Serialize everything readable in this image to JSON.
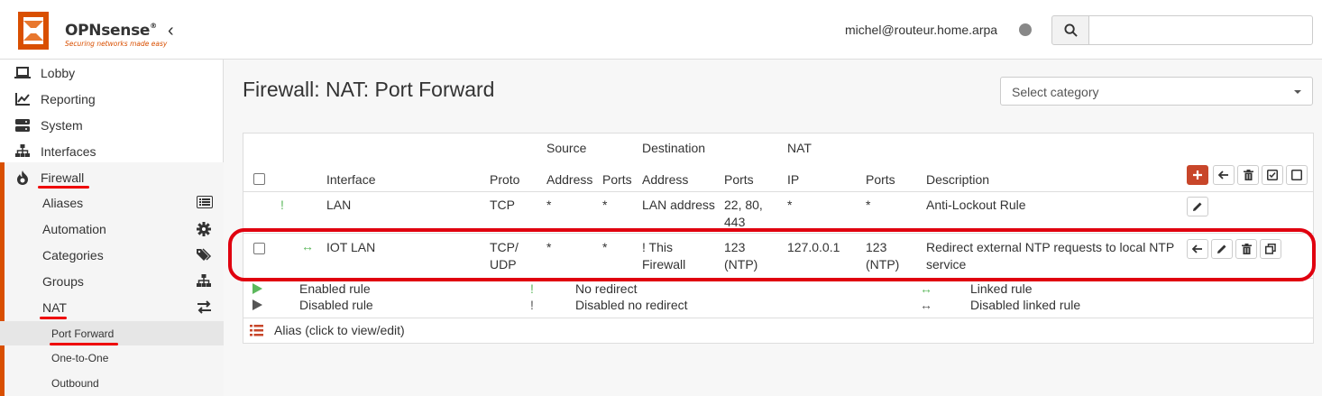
{
  "brand": {
    "name": "OPNsense",
    "tagline": "Securing networks made easy",
    "accent": "#d94f00"
  },
  "header": {
    "user": "michel@routeur.home.arpa",
    "search_placeholder": ""
  },
  "sidebar": {
    "items": [
      {
        "label": "Lobby",
        "icon": "laptop-icon"
      },
      {
        "label": "Reporting",
        "icon": "chart-icon"
      },
      {
        "label": "System",
        "icon": "server-icon"
      },
      {
        "label": "Interfaces",
        "icon": "sitemap-icon"
      },
      {
        "label": "Firewall",
        "icon": "fire-icon"
      }
    ],
    "firewall_sub": [
      {
        "label": "Aliases",
        "icon": "list-icon"
      },
      {
        "label": "Automation",
        "icon": "gear-icon"
      },
      {
        "label": "Categories",
        "icon": "tags-icon"
      },
      {
        "label": "Groups",
        "icon": "sitemap-icon"
      },
      {
        "label": "NAT",
        "icon": "exchange-icon"
      }
    ],
    "nat_sub": [
      {
        "label": "Port Forward"
      },
      {
        "label": "One-to-One"
      },
      {
        "label": "Outbound"
      }
    ]
  },
  "page": {
    "title": "Firewall: NAT: Port Forward",
    "category_placeholder": "Select category"
  },
  "table": {
    "group_headers": {
      "source": "Source",
      "destination": "Destination",
      "nat": "NAT"
    },
    "columns": {
      "interface": "Interface",
      "proto": "Proto",
      "src_address": "Address",
      "src_ports": "Ports",
      "dst_address": "Address",
      "dst_ports": "Ports",
      "nat_ip": "IP",
      "nat_ports": "Ports",
      "description": "Description"
    },
    "rows": [
      {
        "status": "!",
        "interface": "LAN",
        "proto": "TCP",
        "src_address": "*",
        "src_ports": "*",
        "dst_address": "LAN address",
        "dst_ports_1": "22, 80,",
        "dst_ports_2": "443",
        "nat_ip": "*",
        "nat_ports": "*",
        "description": "Anti-Lockout Rule"
      },
      {
        "status": "↔",
        "interface": "IOT LAN",
        "proto_1": "TCP/",
        "proto_2": "UDP",
        "src_address": "*",
        "src_ports": "*",
        "dst_address_1": "! This",
        "dst_address_2": "Firewall",
        "dst_ports_1": "123",
        "dst_ports_2": "(NTP)",
        "nat_ip": "127.0.0.1",
        "nat_ports_1": "123",
        "nat_ports_2": "(NTP)",
        "description_1": "Redirect external NTP requests to local NTP",
        "description_2": "service"
      }
    ]
  },
  "legend": {
    "enabled_rule": "Enabled rule",
    "disabled_rule": "Disabled rule",
    "no_redirect": "No redirect",
    "disabled_no_redirect": "Disabled no redirect",
    "linked_rule": "Linked rule",
    "disabled_linked_rule": "Disabled linked rule",
    "alias": "Alias (click to view/edit)",
    "no_redirect_symbol": "!",
    "linked_symbol": "↔"
  },
  "colors": {
    "enabled_green": "#5cb85c",
    "disabled_gray": "#555555",
    "highlight_red": "#e0000f",
    "add_button": "#c8462a"
  }
}
